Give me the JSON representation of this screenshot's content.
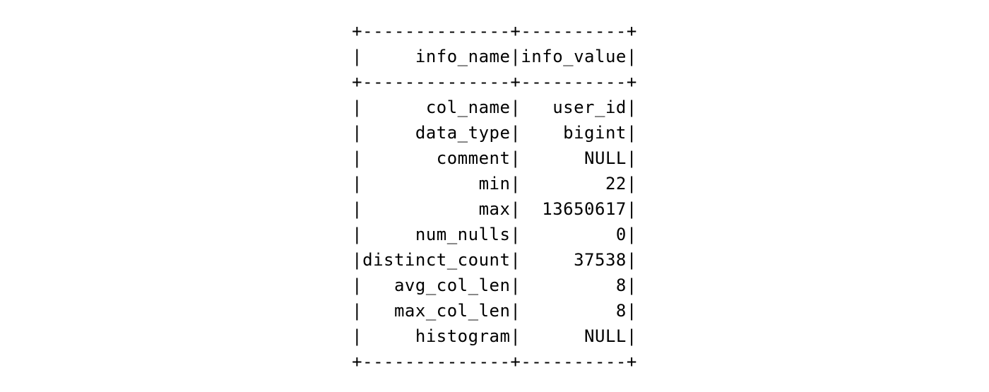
{
  "table": {
    "col1_width": 14,
    "col2_width": 10,
    "header": {
      "col1": "info_name",
      "col2": "info_value"
    },
    "rows": [
      {
        "name": "col_name",
        "value": "user_id"
      },
      {
        "name": "data_type",
        "value": "bigint"
      },
      {
        "name": "comment",
        "value": "NULL"
      },
      {
        "name": "min",
        "value": "22"
      },
      {
        "name": "max",
        "value": "13650617"
      },
      {
        "name": "num_nulls",
        "value": "0"
      },
      {
        "name": "distinct_count",
        "value": "37538"
      },
      {
        "name": "avg_col_len",
        "value": "8"
      },
      {
        "name": "max_col_len",
        "value": "8"
      },
      {
        "name": "histogram",
        "value": "NULL"
      }
    ]
  }
}
